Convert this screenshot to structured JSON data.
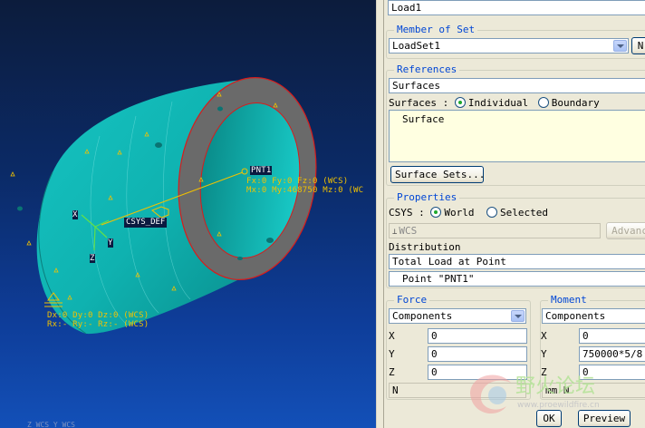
{
  "viewport": {
    "pnt_label": "PNT1",
    "load_line1": "Fx:0 Fy:0 Fz:0 (WCS)",
    "load_line2": "Mx:0 My:468750 Mz:0 (WC",
    "csys_label": "CSYS_DEF",
    "axis_x": "X",
    "axis_y": "Y",
    "axis_z": "Z",
    "constraint_line1": "Dx:0 Dy:0 Dz:0 (WCS)",
    "constraint_line2": "Rx:- Ry:- Rz:- (WCS)",
    "bottom_wcs": "Z  WCS     Y  WCS"
  },
  "dialog": {
    "name_value": "Load1",
    "member_of_set": {
      "title": "Member of Set",
      "value": "LoadSet1",
      "new_button": "N"
    },
    "references": {
      "title": "References",
      "type_value": "Surfaces",
      "surfaces_label": "Surfaces :",
      "individual": "Individual",
      "boundary": "Boundary",
      "list_item": "Surface",
      "surface_sets_button": "Surface Sets..."
    },
    "properties": {
      "title": "Properties",
      "csys_label": "CSYS :",
      "world": "World",
      "selected": "Selected",
      "csys_field": "WCS",
      "advanced_button": "Advanc",
      "distribution_label": "Distribution",
      "distribution_value": "Total Load at Point",
      "point_value": "Point \"PNT1\""
    },
    "force": {
      "title": "Force",
      "mode": "Components",
      "x_label": "X",
      "x_value": "0",
      "y_label": "Y",
      "y_value": "0",
      "z_label": "Z",
      "z_value": "0",
      "unit": "N"
    },
    "moment": {
      "title": "Moment",
      "mode": "Components",
      "x_label": "X",
      "x_value": "0",
      "y_label": "Y",
      "y_value": "750000*5/8",
      "z_label": "Z",
      "z_value": "0",
      "unit": "mm N"
    },
    "ok_button": "OK",
    "preview_button": "Preview"
  },
  "watermark": {
    "text": "野火论坛",
    "sub": "www.proewildfire.cn"
  },
  "colors": {
    "model_cyan": "#0fb2b0",
    "ring_gray": "#6a6a6a",
    "annotation_yellow": "#f2c200",
    "group_title_blue": "#0046d5"
  }
}
